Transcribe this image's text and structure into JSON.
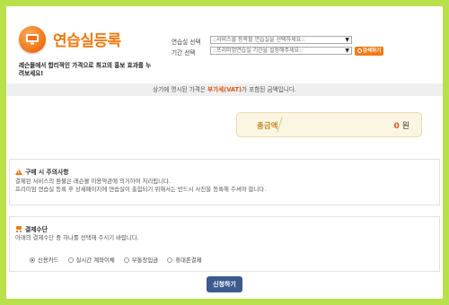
{
  "header": {
    "title": "연습실등록",
    "subtitle": "레슨몰에서 합리적인 가격으로 최고의 홍보 효과를 누려보세요!",
    "icon": "monitor-icon"
  },
  "form": {
    "practice_label": "연습실 선택",
    "practice_value": "::서비스를 등록할 연습실을 선택하세요::",
    "period_label": "기간 선택",
    "period_value": "::프리미엄연습실 기간을 설정해주세요::",
    "search_button": "검색하기"
  },
  "notice": {
    "prefix": "상기에 명시된 가격은 ",
    "highlight": "부가세(VAT)",
    "suffix": "가 포함된 금액입니다."
  },
  "total": {
    "label": "총금액",
    "value": "0",
    "unit": "원"
  },
  "caution": {
    "title": "구매 시 주의사항",
    "line1": "결제된 서비스의 환불은 레슨몰 이용약관에 의거하여 처리됩니다.",
    "line2": "프리미엄 연습실 등록 후 상세페이지에 연습실이 출힘되기 위해서는 반드시 사진을 등록해 주셔야 합니다."
  },
  "payment": {
    "title": "결제수단",
    "description": "아래의 결제수단 중 하나를 선택해 주시기 바랍니다.",
    "options": [
      "신용카드",
      "실시간 계좌이체",
      "무통장입금",
      "휴대폰결제"
    ],
    "selected_index": 0
  },
  "submit_button": "신청하기",
  "colors": {
    "background": "#b7e04a",
    "accent": "#f07a14",
    "submit": "#3d5a8f"
  }
}
